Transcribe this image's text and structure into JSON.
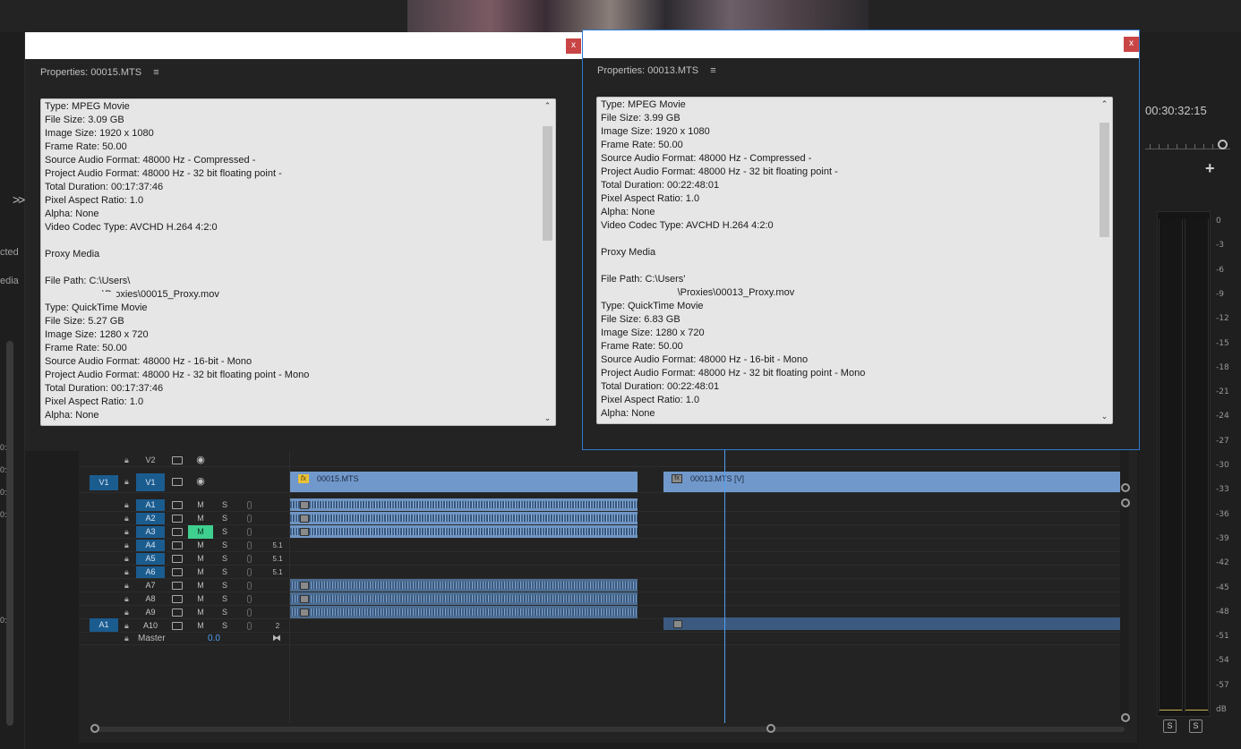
{
  "monitor": {
    "timecode": "00:30:32:15",
    "add_label": "+"
  },
  "left_panel": {
    "frag1": "cted",
    "frag2": "edia",
    "frag3": "0:",
    "frag4": "0:",
    "frag5": "0:",
    "frag6": "0:",
    "frag7": "0:"
  },
  "dialog_left": {
    "title": "Properties: 00015.MTS",
    "menu": "≡",
    "close": "x",
    "lines": [
      "Type: MPEG Movie",
      "File Size: 3.09 GB",
      "Image Size: 1920 x 1080",
      "Frame Rate: 50.00",
      "Source Audio Format: 48000 Hz - Compressed -",
      "Project Audio Format: 48000 Hz - 32 bit floating point -",
      "Total Duration: 00:17:37:46",
      "Pixel Aspect Ratio: 1.0",
      "Alpha: None",
      "Video Codec Type: AVCHD H.264 4:2:0",
      "",
      "Proxy Media",
      "",
      "File Path: C:\\Users\\",
      "                    :\\Proxies\\00015_Proxy.mov",
      "Type: QuickTime Movie",
      "File Size: 5.27 GB",
      "Image Size: 1280 x 720",
      "Frame Rate: 50.00",
      "Source Audio Format: 48000 Hz - 16-bit - Mono",
      "Project Audio Format: 48000 Hz - 32 bit floating point - Mono",
      "Total Duration: 00:17:37:46",
      "Pixel Aspect Ratio: 1.0",
      "Alpha: None"
    ]
  },
  "dialog_right": {
    "title": "Properties: 00013.MTS",
    "menu": "≡",
    "close": "x",
    "lines": [
      "Type: MPEG Movie",
      "File Size: 3.99 GB",
      "Image Size: 1920 x 1080",
      "Frame Rate: 50.00",
      "Source Audio Format: 48000 Hz - Compressed -",
      "Project Audio Format: 48000 Hz - 32 bit floating point -",
      "Total Duration: 00:22:48:01",
      "Pixel Aspect Ratio: 1.0",
      "Alpha: None",
      "Video Codec Type: AVCHD H.264 4:2:0",
      "",
      "Proxy Media",
      "",
      "File Path: C:\\Users'",
      "                            \\Proxies\\00013_Proxy.mov",
      "Type: QuickTime Movie",
      "File Size: 6.83 GB",
      "Image Size: 1280 x 720",
      "Frame Rate: 50.00",
      "Source Audio Format: 48000 Hz - 16-bit - Mono",
      "Project Audio Format: 48000 Hz - 32 bit floating point - Mono",
      "Total Duration: 00:22:48:01",
      "Pixel Aspect Ratio: 1.0",
      "Alpha: None"
    ]
  },
  "timeline": {
    "tracks": {
      "v2": "V2",
      "v1_src": "V1",
      "v1": "V1",
      "a1": "A1",
      "a2": "A2",
      "a3": "A3",
      "a4": "A4",
      "a5": "A5",
      "a6": "A6",
      "a7": "A7",
      "a8": "A8",
      "a9": "A9",
      "a10": "A10",
      "a1_src": "A1",
      "master": "Master",
      "master_vol": "0.0"
    },
    "mute": "M",
    "solo": "S",
    "channel_51": "5.1",
    "channel_2": "2",
    "clips": {
      "clip1": "00015.MTS",
      "clip2": "00013.MTS [V]",
      "fx": "fx"
    }
  },
  "meter": {
    "scale": [
      "0",
      "-3",
      "-6",
      "-9",
      "-12",
      "-15",
      "-18",
      "-21",
      "-24",
      "-27",
      "-30",
      "-33",
      "-36",
      "-39",
      "-42",
      "-45",
      "-48",
      "-51",
      "-54",
      "-57",
      "dB"
    ],
    "solo_left": "S",
    "solo_right": "S"
  }
}
